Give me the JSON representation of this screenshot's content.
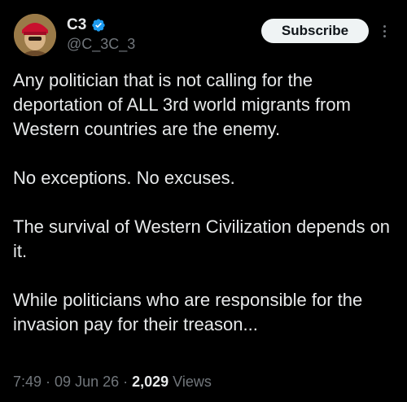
{
  "author": {
    "display_name": "C3",
    "handle": "@C_3C_3",
    "verified": true,
    "avatar_icon": "avatar-image"
  },
  "actions": {
    "subscribe_label": "Subscribe",
    "more_icon": "more-vertical-icon"
  },
  "post": {
    "text": "Any politician that is not calling for the deportation of ALL 3rd world migrants from Western countries are the enemy.\n\nNo exceptions. No excuses.\n\nThe survival of Western Civilization depends on it.\n\nWhile politicians who are responsible for the invasion pay for their treason..."
  },
  "meta": {
    "time": "7:49",
    "sep1": "·",
    "date": "09 Jun 26",
    "sep2": "·",
    "views_count": "2,029",
    "views_label": "Views"
  },
  "colors": {
    "background": "#000000",
    "text": "#e7e9ea",
    "muted": "#71767b",
    "verified": "#1d9bf0",
    "button_bg": "#eff3f4"
  }
}
